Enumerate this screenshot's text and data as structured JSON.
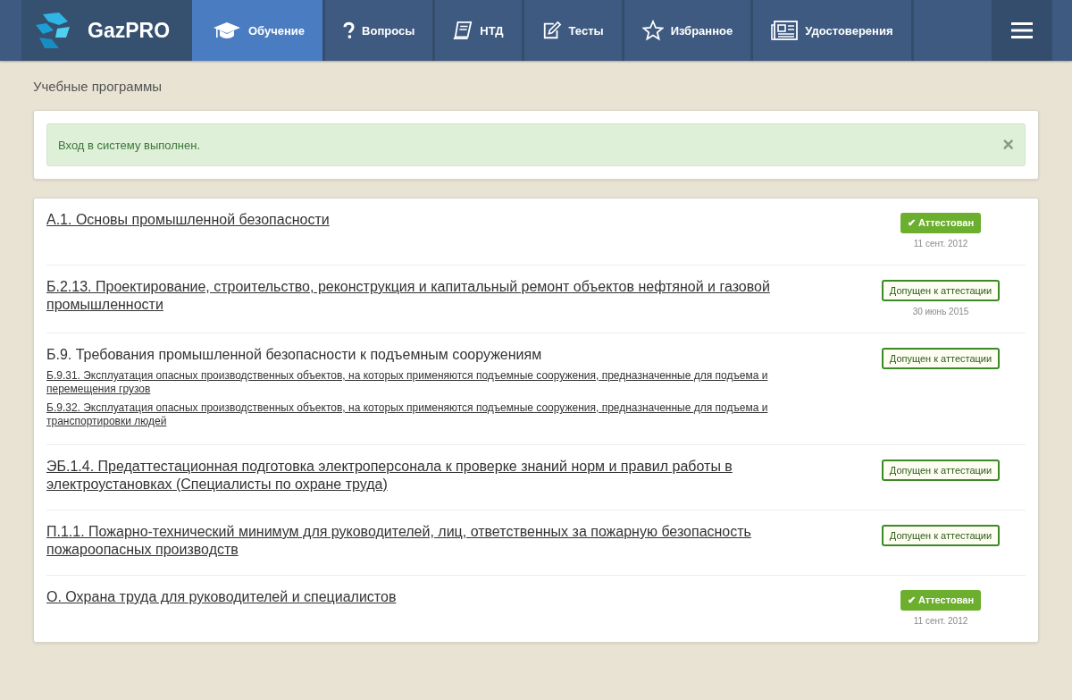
{
  "brand": "GazPRO",
  "nav": [
    {
      "label": "Обучение",
      "kind": "cap",
      "selected": true
    },
    {
      "label": "Вопросы",
      "kind": "question",
      "selected": false
    },
    {
      "label": "НТД",
      "kind": "book",
      "selected": false
    },
    {
      "label": "Тесты",
      "kind": "edit",
      "selected": false
    },
    {
      "label": "Избранное",
      "kind": "star",
      "selected": false
    },
    {
      "label": "Удостоверения",
      "kind": "news",
      "selected": false
    }
  ],
  "page_title": "Учебные программы",
  "alert": {
    "text": "Вход в систему выполнен.",
    "close": "×"
  },
  "programs": [
    {
      "title": "А.1. Основы промышленной безопасности",
      "link": true,
      "status": {
        "kind": "attested",
        "label": "Аттестован",
        "check": "✔"
      },
      "date": "11 сент. 2012"
    },
    {
      "title": "Б.2.13. Проектирование, строительство, реконструкция и капитальный ремонт объектов нефтяной и газовой промышленности",
      "link": true,
      "status": {
        "kind": "admitted",
        "label": "Допущен к аттестации"
      },
      "date": "30 июнь 2015"
    },
    {
      "title": "Б.9. Требования промышленной безопасности к подъемным сооружениям",
      "link": false,
      "status": {
        "kind": "admitted",
        "label": "Допущен к аттестации"
      },
      "children": [
        {
          "title": "Б.9.31. Эксплуатация опасных производственных объектов, на которых применяются подъемные сооружения, предназначенные для подъема и перемещения грузов"
        },
        {
          "title": "Б.9.32. Эксплуатация опасных производственных объектов, на которых применяются подъемные сооружения, предназначенные для подъема и транспортировки людей"
        }
      ]
    },
    {
      "title": "ЭБ.1.4. Предаттестационная подготовка электроперсонала к проверке знаний норм и правил работы в электроустановках (Специалисты по охране труда)",
      "link": true,
      "status": {
        "kind": "admitted",
        "label": "Допущен к аттестации"
      }
    },
    {
      "title": "П.1.1. Пожарно-технический минимум для руководителей, лиц, ответственных за пожарную безопасность пожароопасных производств",
      "link": true,
      "status": {
        "kind": "admitted",
        "label": "Допущен к аттестации"
      }
    },
    {
      "title": "О. Охрана труда для руководителей и специалистов",
      "link": true,
      "status": {
        "kind": "attested",
        "label": "Аттестован",
        "check": "✔"
      },
      "date": "11 сент. 2012"
    }
  ]
}
